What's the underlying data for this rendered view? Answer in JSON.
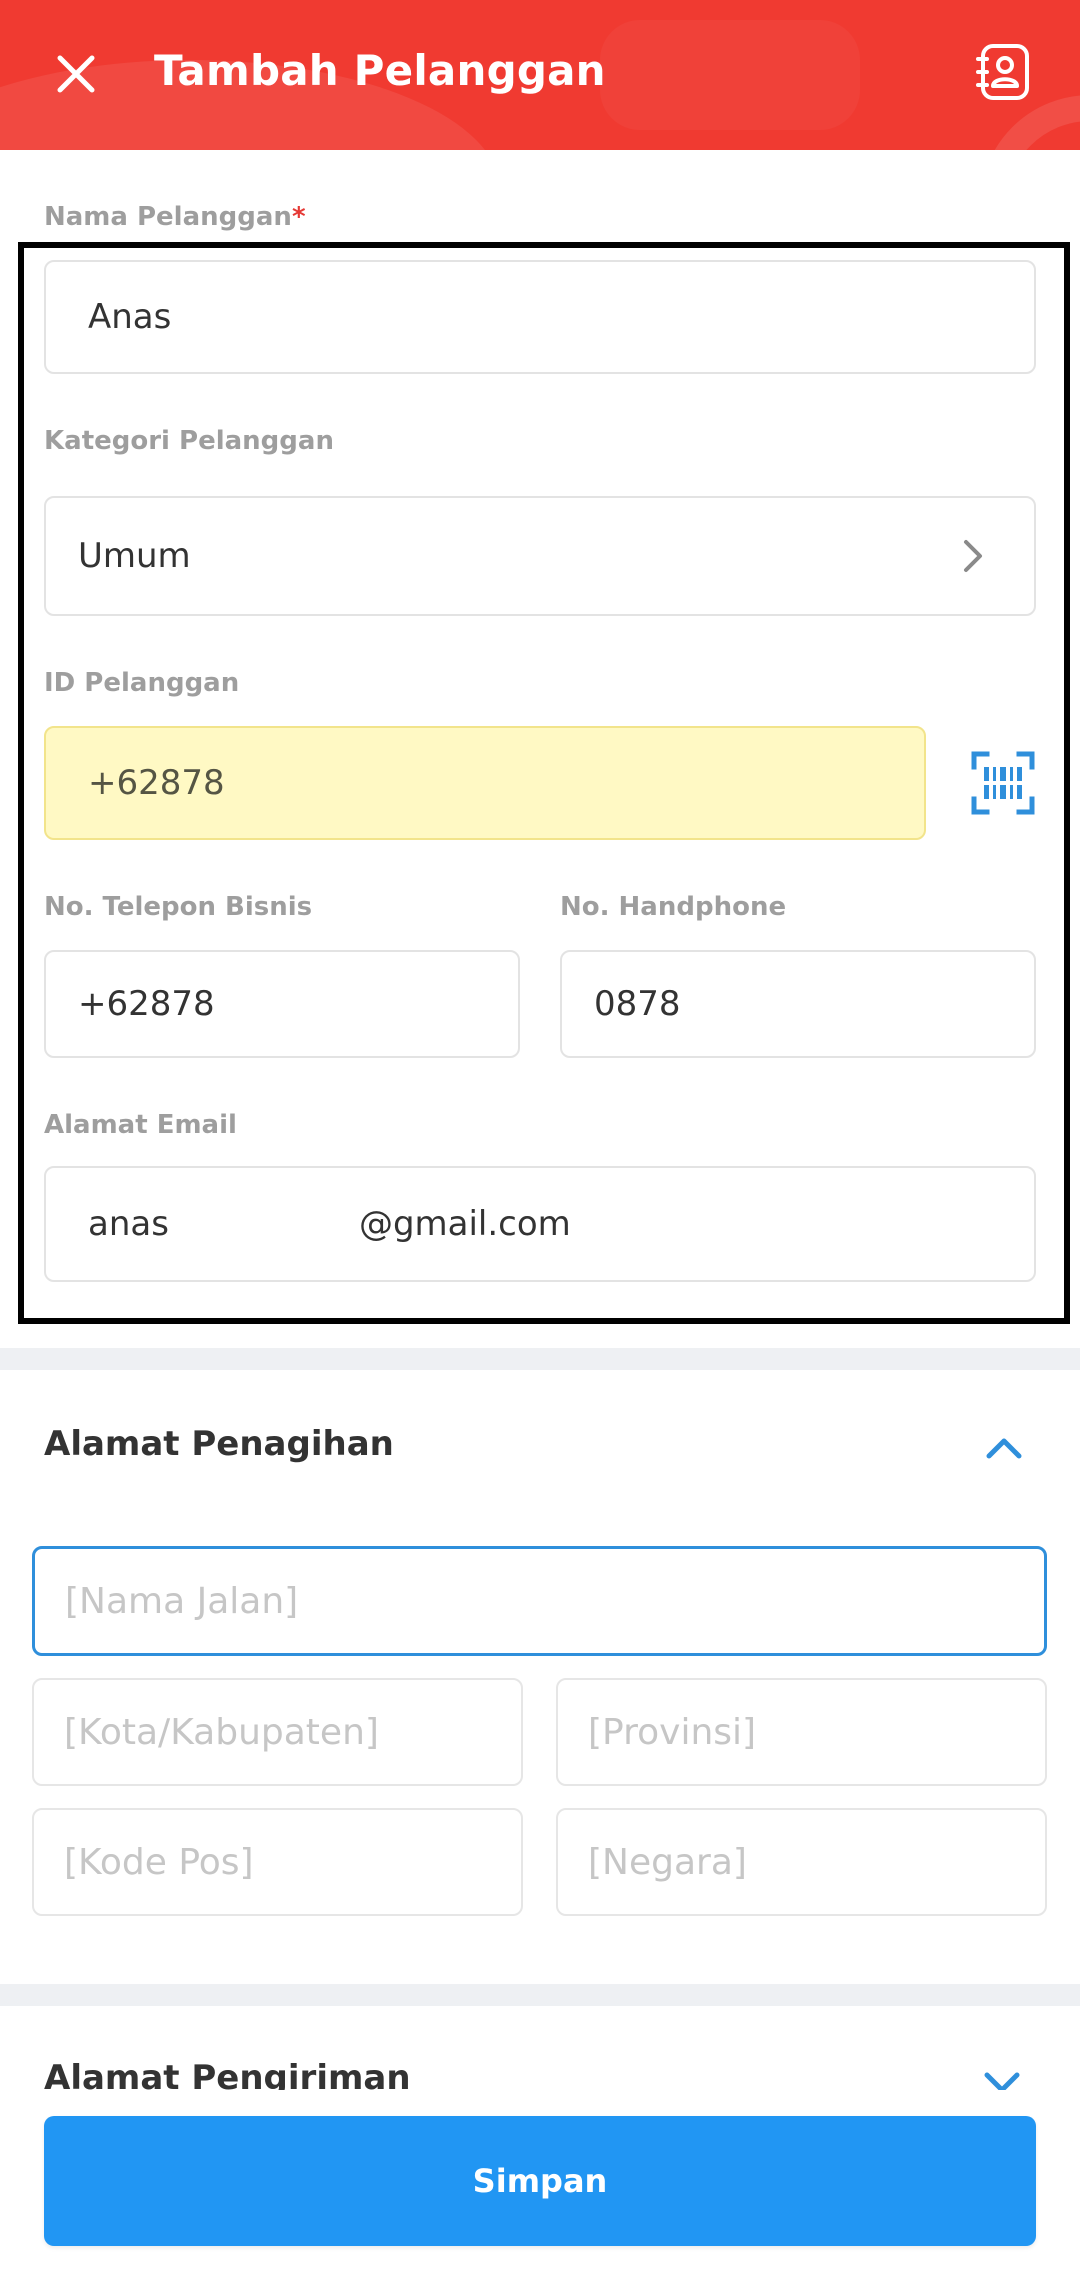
{
  "header": {
    "title": "Tambah Pelanggan",
    "close_icon": "close-icon",
    "contacts_icon": "contact-book-icon",
    "background_color": "#f03a31"
  },
  "form": {
    "nama": {
      "label": "Nama Pelanggan",
      "required_mark": "*",
      "value": "Anas"
    },
    "kategori": {
      "label": "Kategori Pelanggan",
      "value": "Umum"
    },
    "id_pelanggan": {
      "label": "ID Pelanggan",
      "value": "+62878",
      "scan_icon": "barcode-scan-icon"
    },
    "telepon_bisnis": {
      "label": "No. Telepon Bisnis",
      "value": "+62878"
    },
    "handphone": {
      "label": "No. Handphone",
      "value": "0878"
    },
    "email": {
      "label": "Alamat Email",
      "value_user": "anas",
      "value_domain": "@gmail.com"
    }
  },
  "billing": {
    "title": "Alamat Penagihan",
    "expanded": true,
    "street_placeholder": "[Nama Jalan]",
    "city_placeholder": "[Kota/Kabupaten]",
    "province_placeholder": "[Provinsi]",
    "postal_placeholder": "[Kode Pos]",
    "country_placeholder": "[Negara]"
  },
  "shipping": {
    "title": "Alamat Pengiriman",
    "expanded": false
  },
  "actions": {
    "save_label": "Simpan"
  },
  "colors": {
    "accent_blue": "#2196f3",
    "focus_border": "#2f8fdb",
    "required": "#e53935",
    "highlight": "#fff9c4"
  }
}
